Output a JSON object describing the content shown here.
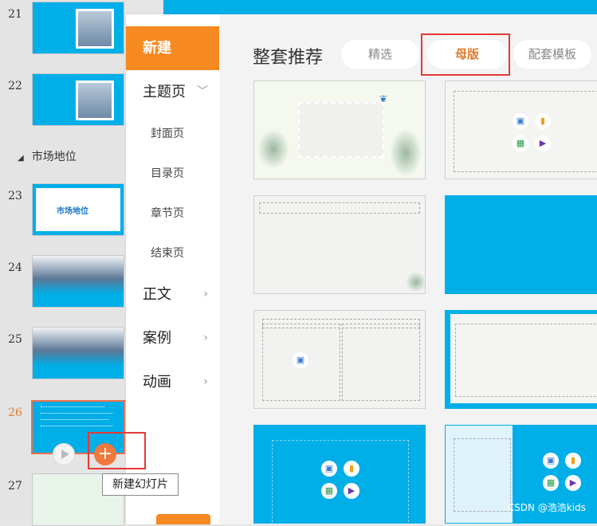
{
  "slides_panel": {
    "slides": [
      {
        "num": "21"
      },
      {
        "num": "22"
      },
      {
        "num": "23",
        "title": "市场地位"
      },
      {
        "num": "24"
      },
      {
        "num": "25"
      },
      {
        "num": "26"
      },
      {
        "num": "27"
      }
    ],
    "section_label": "市场地位",
    "new_slide_tooltip": "新建幻灯片"
  },
  "menu": {
    "items": [
      {
        "label": "新建"
      },
      {
        "label": "主题页"
      },
      {
        "label": "封面页"
      },
      {
        "label": "目录页"
      },
      {
        "label": "章节页"
      },
      {
        "label": "结束页"
      },
      {
        "label": "正文"
      },
      {
        "label": "案例"
      },
      {
        "label": "动画"
      }
    ]
  },
  "main": {
    "title": "整套推荐",
    "tabs": [
      {
        "label": "精选"
      },
      {
        "label": "母版"
      },
      {
        "label": "配套模板"
      }
    ]
  },
  "watermark": "CSDN @浩浩kids",
  "colors": {
    "accent": "#f6891f",
    "blue": "#00aee8",
    "highlight": "#e53935"
  }
}
